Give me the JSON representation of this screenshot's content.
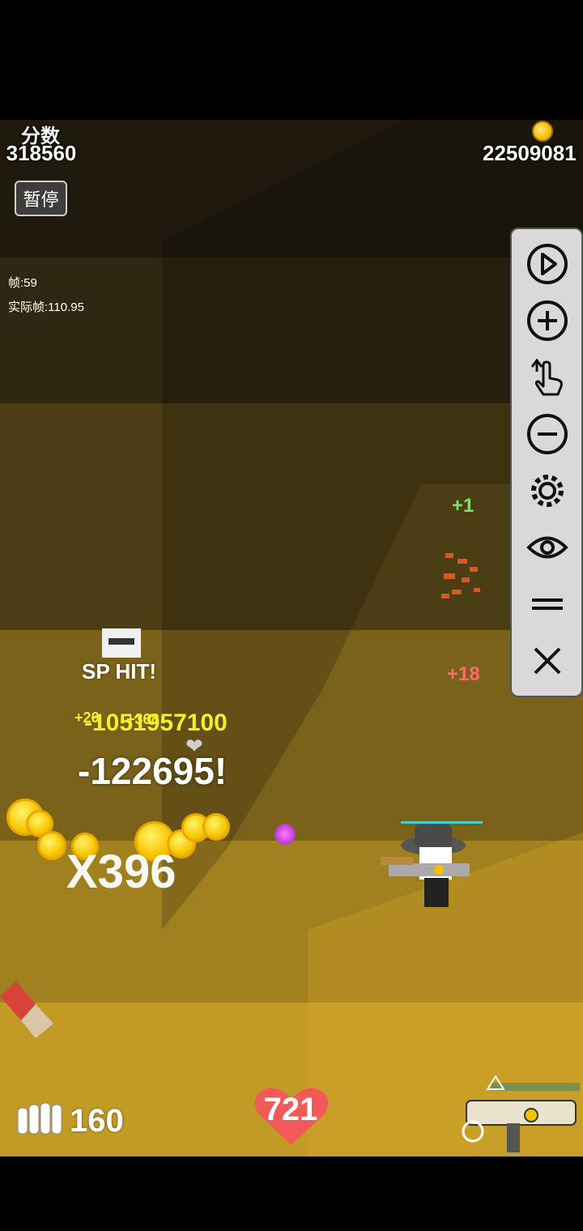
{
  "hud": {
    "score_label": "分数",
    "score_value": "318560",
    "coins_value": "22509081",
    "pause_label": "暂停",
    "fps_label": "帧:59",
    "real_fps_label": "实际帧:110.95"
  },
  "side_menu": {
    "items": [
      {
        "name": "play",
        "icon": "play-icon"
      },
      {
        "name": "zoom-in",
        "icon": "plus-circle-icon"
      },
      {
        "name": "tap",
        "icon": "hand-pointer-icon"
      },
      {
        "name": "zoom-out",
        "icon": "minus-circle-icon"
      },
      {
        "name": "settings",
        "icon": "gear-icon"
      },
      {
        "name": "view",
        "icon": "eye-icon"
      },
      {
        "name": "menu",
        "icon": "equals-icon"
      },
      {
        "name": "close",
        "icon": "close-icon"
      }
    ]
  },
  "combat": {
    "sp_hit": "SP HIT!",
    "damage_big": "-122695!",
    "damage_yellow": "-1051957100",
    "small_plus": "+26",
    "small_plus_2": "+368",
    "combo": "X396",
    "plus_one": "+1",
    "plus_eighteen": "+18"
  },
  "player": {
    "ammo": "160",
    "hp": "721"
  },
  "colors": {
    "heart": "#f25a5a",
    "menu_bg": "#d9d9d9",
    "damage_yellow": "#f5ee2a",
    "heal_green": "#7de06b"
  }
}
